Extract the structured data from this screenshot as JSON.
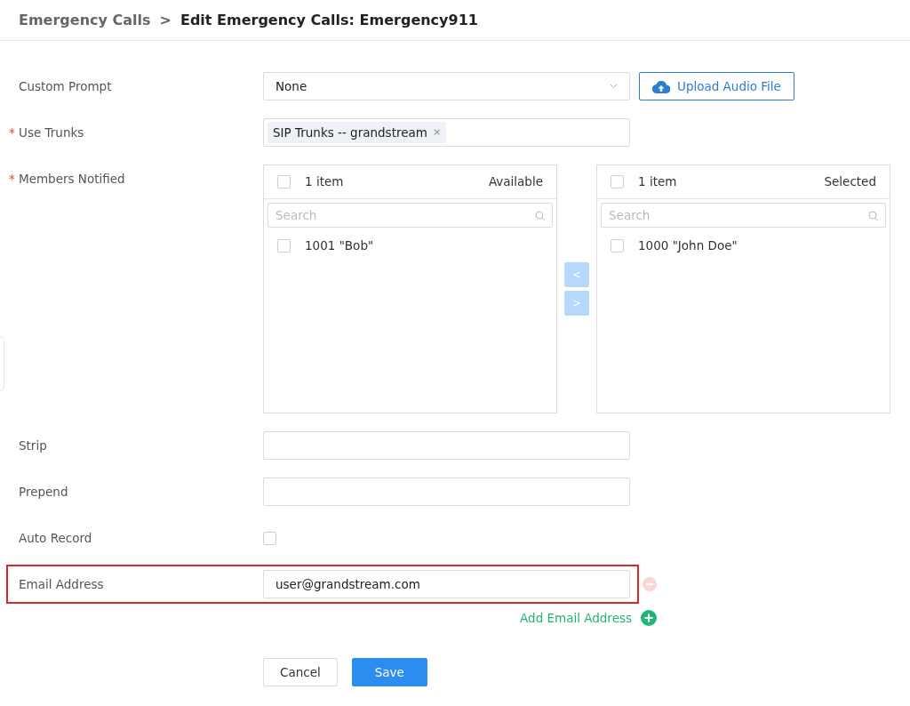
{
  "breadcrumb": {
    "parent": "Emergency Calls",
    "separator": ">",
    "current": "Edit Emergency Calls: Emergency911"
  },
  "required_mark": "*",
  "fields": [
    {
      "kind": "select",
      "label": "Custom Prompt",
      "required": false,
      "value": "None",
      "action": "Upload Audio File"
    },
    {
      "kind": "tags",
      "label": "Use Trunks",
      "required": true,
      "tags": [
        {
          "label": "SIP Trunks -- grandstream",
          "remove": "×"
        }
      ]
    },
    {
      "kind": "transfer",
      "label": "Members Notified",
      "required": true,
      "lists": [
        {
          "count": "1 item",
          "title": "Available",
          "placeholder": "Search",
          "checked": false,
          "items": [
            {
              "label": "1001 \"Bob\"",
              "checked": false
            }
          ]
        },
        {
          "count": "1 item",
          "title": "Selected",
          "placeholder": "Search",
          "checked": false,
          "items": [
            {
              "label": "1000 \"John Doe\"",
              "checked": false
            }
          ]
        }
      ],
      "buttons": [
        {
          "label": "<",
          "disabled": true
        },
        {
          "label": ">",
          "disabled": true
        }
      ]
    },
    {
      "kind": "text",
      "label": "Strip",
      "required": false
    },
    {
      "kind": "text",
      "label": "Prepend",
      "required": false
    },
    {
      "kind": "checkbox",
      "label": "Auto Record",
      "required": false,
      "checked": false
    },
    {
      "kind": "email",
      "label": "Email Address",
      "required": false,
      "value": "user@grandstream.com",
      "highlighted": true,
      "remove_disabled": true,
      "add_label": "Add Email Address"
    }
  ],
  "buttons": [
    {
      "label": "Cancel",
      "kind": "secondary"
    },
    {
      "label": "Save",
      "kind": "primary"
    }
  ]
}
